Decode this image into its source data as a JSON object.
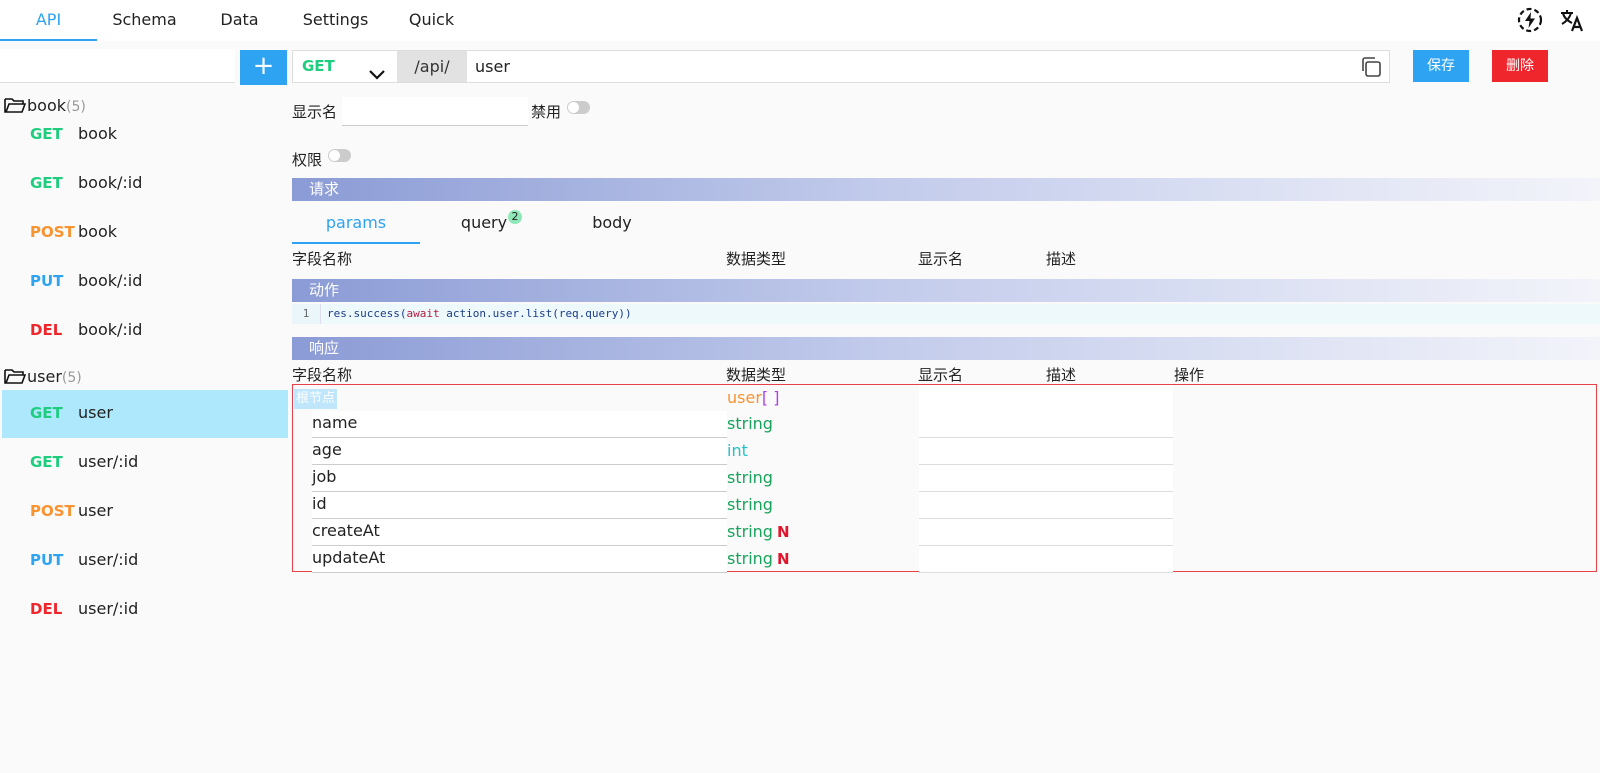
{
  "topnav": {
    "tabs": [
      {
        "label": "API"
      },
      {
        "label": "Schema"
      },
      {
        "label": "Data"
      },
      {
        "label": "Settings"
      },
      {
        "label": "Quick"
      }
    ],
    "icons": [
      "lightning-circle-icon",
      "translate-icon"
    ]
  },
  "sidebar": {
    "add_label": "+",
    "groups": [
      {
        "name": "book",
        "count": "(5)",
        "items": [
          {
            "method": "GET",
            "path": "book"
          },
          {
            "method": "GET",
            "path": "book/:id"
          },
          {
            "method": "POST",
            "path": "book"
          },
          {
            "method": "PUT",
            "path": "book/:id"
          },
          {
            "method": "DEL",
            "path": "book/:id"
          }
        ]
      },
      {
        "name": "user",
        "count": "(5)",
        "items": [
          {
            "method": "GET",
            "path": "user"
          },
          {
            "method": "GET",
            "path": "user/:id"
          },
          {
            "method": "POST",
            "path": "user"
          },
          {
            "method": "PUT",
            "path": "user/:id"
          },
          {
            "method": "DEL",
            "path": "user/:id"
          }
        ]
      }
    ]
  },
  "urlbar": {
    "method": "GET",
    "prefix": "/api/",
    "path": "user",
    "save_label": "保存",
    "delete_label": "删除"
  },
  "form": {
    "display_name_label": "显示名",
    "display_name_value": "",
    "disabled_label": "禁用",
    "permission_label": "权限"
  },
  "request": {
    "title": "请求",
    "tabs": [
      {
        "label": "params"
      },
      {
        "label": "query",
        "badge": "2"
      },
      {
        "label": "body"
      }
    ],
    "columns": [
      "字段名称",
      "数据类型",
      "显示名",
      "描述"
    ]
  },
  "action": {
    "title": "动作",
    "line_number": "1",
    "code_pre": "res.success(",
    "code_kw": "await",
    "code_post": " action.user.list(req.query))"
  },
  "response": {
    "title": "响应",
    "columns": [
      "字段名称",
      "数据类型",
      "显示名",
      "描述",
      "操作"
    ],
    "root": {
      "label": "根节点",
      "type": "user",
      "type_suffix": "[ ]"
    },
    "fields": [
      {
        "name": "name",
        "type": "string",
        "nullable": ""
      },
      {
        "name": "age",
        "type": "int",
        "nullable": ""
      },
      {
        "name": "job",
        "type": "string",
        "nullable": ""
      },
      {
        "name": "id",
        "type": "string",
        "nullable": ""
      },
      {
        "name": "createAt",
        "type": "string",
        "nullable": "N"
      },
      {
        "name": "updateAt",
        "type": "string",
        "nullable": "N"
      }
    ]
  },
  "colors": {
    "accent": "#2ea3f2",
    "get": "#1ece7e",
    "post": "#f89330",
    "put": "#2ea3f2",
    "del": "#f0262d"
  }
}
